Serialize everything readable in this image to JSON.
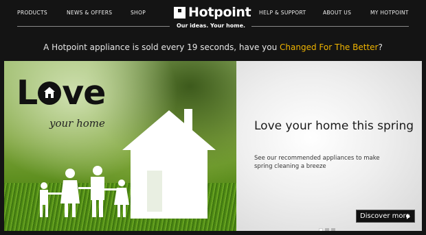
{
  "nav": {
    "left": [
      "PRODUCTS",
      "NEWS & OFFERS",
      "SHOP"
    ],
    "right": [
      "HELP & SUPPORT",
      "ABOUT US",
      "MY HOTPOINT"
    ]
  },
  "logo": {
    "name": "Hotpoint",
    "tagline": "Our ideas. Your home."
  },
  "announcement": {
    "text": "A Hotpoint appliance is sold every 19 seconds, have you ",
    "link": "Changed For The Better",
    "suffix": "?"
  },
  "hero": {
    "image_title_left": "L",
    "image_title_right": "ve",
    "image_subtitle": "your home",
    "heading": "Love your home this spring",
    "body": "See our recommended appliances to make spring cleaning a breeze",
    "cta": "Discover more",
    "slide_count": 3,
    "active_slide": 1
  },
  "colors": {
    "background": "#141414",
    "accent": "#f0b400",
    "text": "#ffffff"
  }
}
